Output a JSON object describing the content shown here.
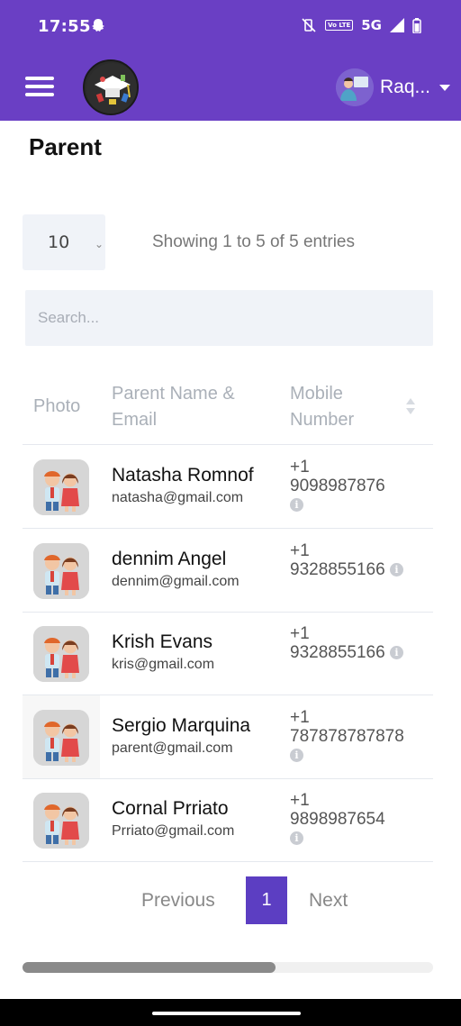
{
  "status_bar": {
    "time": "17:55",
    "network": "5G",
    "volte": "Vo LTE"
  },
  "app_bar": {
    "user_name": "Raq..."
  },
  "page": {
    "title": "Parent"
  },
  "table_controls": {
    "page_length": "10",
    "info": "Showing 1 to 5 of 5 entries",
    "search_placeholder": "Search..."
  },
  "table": {
    "columns": {
      "photo": "Photo",
      "name_email": "Parent Name & Email",
      "mobile": "Mobile Number"
    },
    "rows": [
      {
        "name": "Natasha Romnof",
        "email": "natasha@gmail.com",
        "mobile_l1": "+1",
        "mobile_l2": "9098987876"
      },
      {
        "name": "dennim Angel",
        "email": "dennim@gmail.com",
        "mobile_l1": "+1",
        "mobile_l2": "9328855166"
      },
      {
        "name": "Krish Evans",
        "email": "kris@gmail.com",
        "mobile_l1": "+1",
        "mobile_l2": "9328855166"
      },
      {
        "name": "Sergio Marquina",
        "email": "parent@gmail.com",
        "mobile_l1": "+1",
        "mobile_l2": "787878787878"
      },
      {
        "name": "Cornal Prriato",
        "email": "Prriato@gmail.com",
        "mobile_l1": "+1",
        "mobile_l2": "9898987654"
      }
    ]
  },
  "pagination": {
    "previous": "Previous",
    "current": "1",
    "next": "Next"
  },
  "colors": {
    "primary": "#6a3fc4",
    "active_page": "#5c3ec2"
  }
}
